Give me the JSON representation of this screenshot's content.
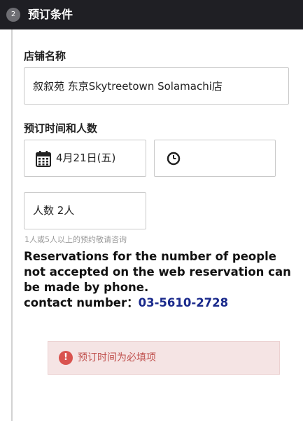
{
  "header": {
    "step_number": "2",
    "title": "预订条件"
  },
  "store": {
    "label": "店铺名称",
    "value": "叙叙苑 东京Skytreetown Solamachi店"
  },
  "datetime": {
    "label": "预订时间和人数",
    "date_icon": "calendar-icon",
    "date_value": "4月21日(五)",
    "time_icon": "clock-icon",
    "time_value": ""
  },
  "party": {
    "value": "人数 2人"
  },
  "hint": "1人或5人以上的预约敬请咨询",
  "notice": {
    "line1": "Reservations for the number of people not accepted on the web reservation can be made by phone.",
    "contact_label": "contact number：",
    "phone": "03-5610-2728"
  },
  "error": {
    "icon": "exclamation-icon",
    "message": "预订时间为必填项"
  },
  "colors": {
    "header_bg": "#1f1f24",
    "phone_link": "#1a2a8c",
    "error_bg": "#f5e4e4",
    "error_text": "#c0504d"
  }
}
